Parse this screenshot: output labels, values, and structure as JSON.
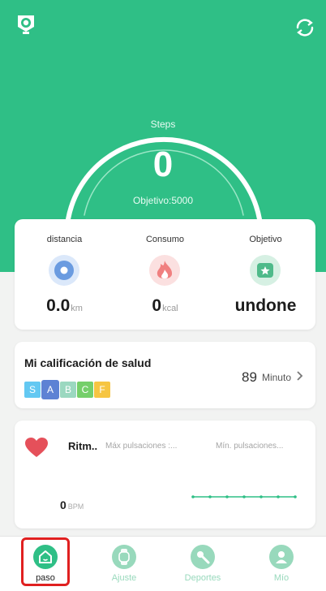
{
  "colors": {
    "brand": "#2fbf86",
    "nav_inactive": "#98d9bc",
    "grade_s": "#63c8f2",
    "grade_a": "#5d82d4",
    "grade_b": "#9bd8c0",
    "grade_c": "#75cf6a",
    "grade_f": "#f6c542",
    "heart": "#e5505a"
  },
  "header": {
    "left_icon": "trophy-badge-icon",
    "right_icon": "sync-icon"
  },
  "steps": {
    "label": "Steps",
    "value": "0",
    "goal_text": "Objetivo:5000",
    "progress_fraction": 0
  },
  "stats": [
    {
      "label": "distancia",
      "value": "0.0",
      "unit": "km",
      "icon": "location-pin-icon",
      "color": "#6a9be0"
    },
    {
      "label": "Consumo",
      "value": "0",
      "unit": "kcal",
      "icon": "flame-icon",
      "color": "#f08080"
    },
    {
      "label": "Objetivo",
      "value": "undone",
      "unit": "",
      "icon": "star-flag-icon",
      "color": "#4fba8a"
    }
  ],
  "health": {
    "title": "Mi calificación de salud",
    "grades": [
      "S",
      "A",
      "B",
      "C",
      "F"
    ],
    "selected_grade": "A",
    "value": "89",
    "unit": "Minuto",
    "chevron": "chevron-right-icon"
  },
  "heart_rate": {
    "title": "Ritm..",
    "max_label": "Máx pulsaciones :...",
    "min_label": "Mín. pulsaciones...",
    "value": "0",
    "unit": "BPM",
    "icon": "heart-icon"
  },
  "nav": [
    {
      "label": "paso",
      "icon": "home-icon",
      "active": true
    },
    {
      "label": "Ajuste",
      "icon": "watch-icon",
      "active": false
    },
    {
      "label": "Deportes",
      "icon": "sports-icon",
      "active": false
    },
    {
      "label": "Mío",
      "icon": "profile-icon",
      "active": false
    }
  ]
}
